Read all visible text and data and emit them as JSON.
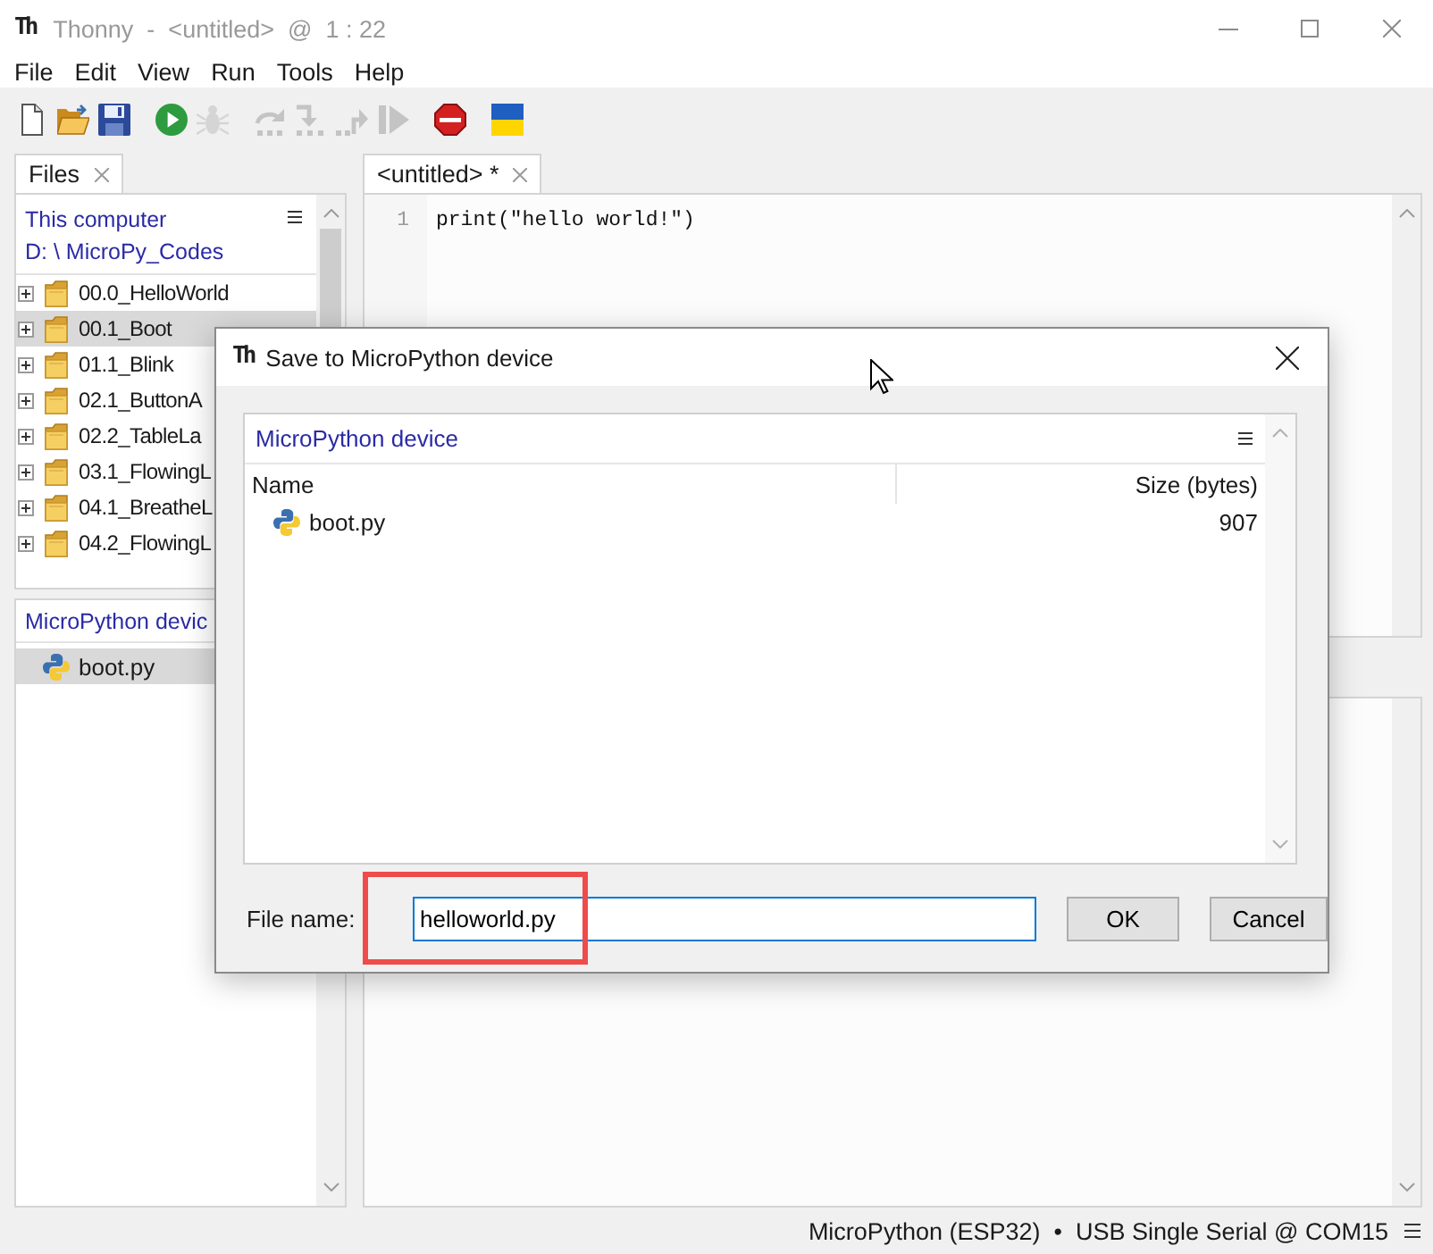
{
  "window": {
    "logo": "Th",
    "title": "Thonny  -  <untitled>  @  1 : 22"
  },
  "menu": [
    "File",
    "Edit",
    "View",
    "Run",
    "Tools",
    "Help"
  ],
  "toolbar": [
    {
      "buttons": [
        {
          "kind": "new",
          "disabled": false
        },
        {
          "kind": "open",
          "disabled": false
        },
        {
          "kind": "save",
          "disabled": false
        }
      ]
    },
    {
      "buttons": [
        {
          "kind": "run",
          "disabled": false
        },
        {
          "kind": "debug",
          "disabled": true
        }
      ]
    },
    {
      "buttons": [
        {
          "kind": "step-over",
          "disabled": true
        },
        {
          "kind": "step-into",
          "disabled": true
        },
        {
          "kind": "step-out",
          "disabled": true
        },
        {
          "kind": "resume",
          "disabled": true
        }
      ]
    },
    {
      "buttons": [
        {
          "kind": "stop",
          "disabled": false
        }
      ]
    },
    {
      "buttons": [
        {
          "kind": "flag",
          "disabled": false
        }
      ]
    }
  ],
  "side_tabs": [
    {
      "label": "Files",
      "selected": true
    }
  ],
  "files": {
    "title": "This computer",
    "path": "D: \\ MicroPy_Codes",
    "items": [
      {
        "name": "00.0_HelloWorld",
        "selected": false,
        "expanded": false
      },
      {
        "name": "00.1_Boot",
        "selected": true,
        "expanded": false
      },
      {
        "name": "01.1_Blink",
        "selected": false,
        "expanded": false
      },
      {
        "name": "02.1_ButtonA",
        "selected": false,
        "expanded": false
      },
      {
        "name": "02.2_TableLa",
        "selected": false,
        "expanded": false
      },
      {
        "name": "03.1_FlowingL",
        "selected": false,
        "expanded": false
      },
      {
        "name": "04.1_BreatheL",
        "selected": false,
        "expanded": false
      },
      {
        "name": "04.2_FlowingL",
        "selected": false,
        "expanded": false
      }
    ]
  },
  "device_files": {
    "title": "MicroPython devic",
    "items": [
      {
        "name": "boot.py",
        "selected": true
      }
    ]
  },
  "editor": {
    "tabs": [
      {
        "label": "<untitled> *",
        "selected": true
      }
    ],
    "lines": [
      {
        "number": "1",
        "code": "print(\"hello world!\")"
      }
    ]
  },
  "status_bar": {
    "backend": "MicroPython (ESP32)  •  USB Single Serial @ COM15"
  },
  "dialog": {
    "logo": "Th",
    "title": "Save to MicroPython device",
    "panel_title": "MicroPython device",
    "columns": [
      "Name",
      "Size (bytes)"
    ],
    "rows": [
      {
        "name": "boot.py",
        "size": "907",
        "selected": false
      }
    ],
    "file_label": "File name:",
    "file_name": "helloworld.py",
    "buttons": [
      "OK",
      "Cancel"
    ]
  }
}
